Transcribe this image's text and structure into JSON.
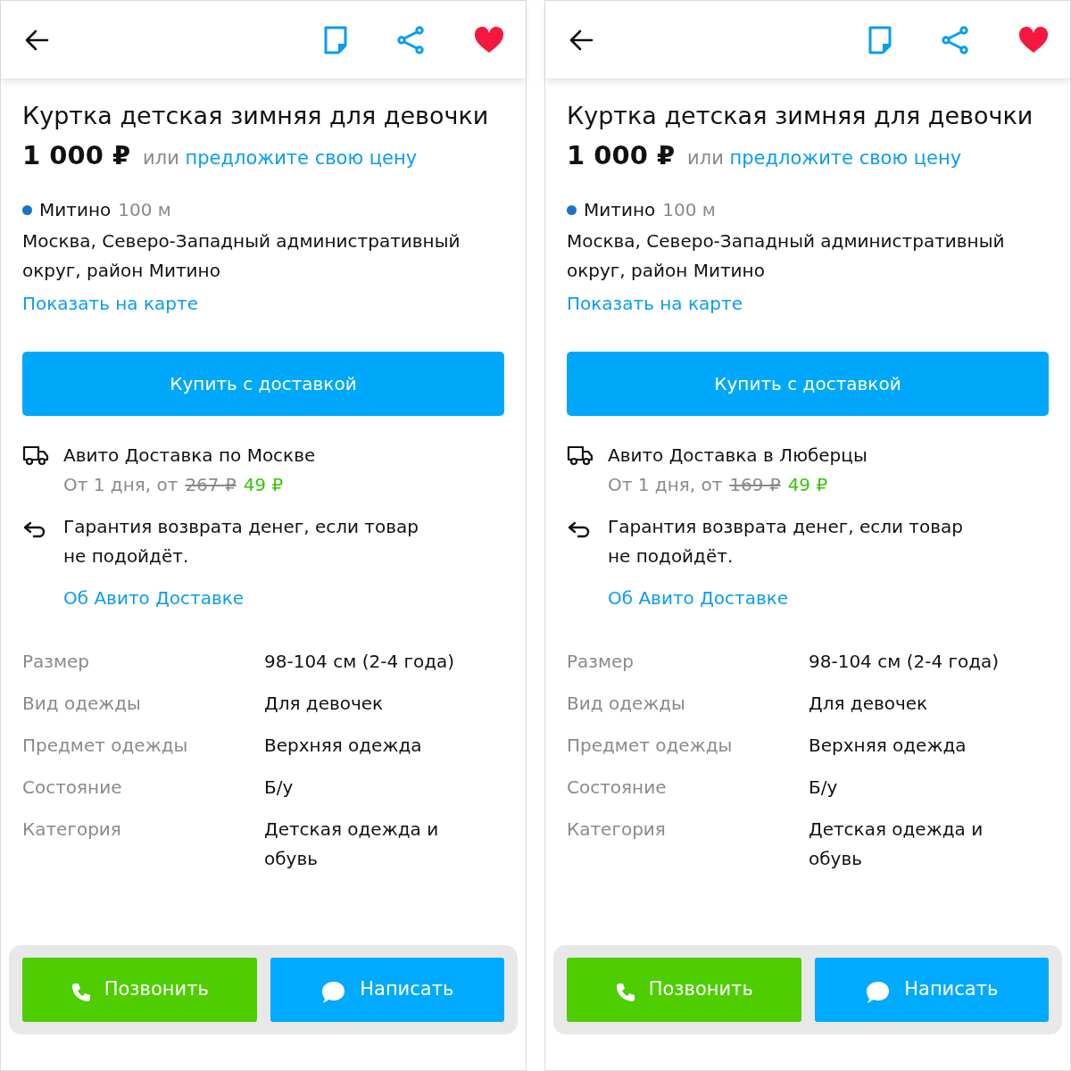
{
  "screens": [
    {
      "favorite": true,
      "title": "Куртка детская зимняя для девочки",
      "price": "1 000 ₽",
      "price_or": "или",
      "offer_link": "предложите свою цену",
      "metro": {
        "station": "Митино",
        "distance": "100 м",
        "color": "#1a73c8"
      },
      "address": "Москва, Северо-Западный административный округ, район Митино",
      "map_link": "Показать на карте",
      "buy_button": "Купить с доставкой",
      "delivery": {
        "title": "Авито Доставка по Москве",
        "terms": "От 1 дня, от",
        "old_price": "267 ₽",
        "new_price": "49 ₽"
      },
      "guarantee": "Гарантия возврата денег, если товар не подойдёт.",
      "about_link": "Об Авито Доставке",
      "params": [
        {
          "label": "Размер",
          "value": "98-104 см (2-4 года)"
        },
        {
          "label": "Вид одежды",
          "value": "Для девочек"
        },
        {
          "label": "Предмет одежды",
          "value": "Верхняя одежда"
        },
        {
          "label": "Состояние",
          "value": "Б/у"
        },
        {
          "label": "Категория",
          "value": "Детская одежда и обувь"
        }
      ],
      "call_button": "Позвонить",
      "write_button": "Написать"
    },
    {
      "favorite": true,
      "title": "Куртка детская зимняя для девочки",
      "price": "1 000 ₽",
      "price_or": "или",
      "offer_link": "предложите свою цену",
      "metro": {
        "station": "Митино",
        "distance": "100 м",
        "color": "#1a73c8"
      },
      "address": "Москва, Северо-Западный административный округ, район Митино",
      "map_link": "Показать на карте",
      "buy_button": "Купить с доставкой",
      "delivery": {
        "title": "Авито Доставка в Люберцы",
        "terms": "От 1 дня, от",
        "old_price": "169 ₽",
        "new_price": "49 ₽"
      },
      "guarantee": "Гарантия возврата денег, если товар не подойдёт.",
      "about_link": "Об Авито Доставке",
      "params": [
        {
          "label": "Размер",
          "value": "98-104 см (2-4 года)"
        },
        {
          "label": "Вид одежды",
          "value": "Для девочек"
        },
        {
          "label": "Предмет одежды",
          "value": "Верхняя одежда"
        },
        {
          "label": "Состояние",
          "value": "Б/у"
        },
        {
          "label": "Категория",
          "value": "Детская одежда и обувь"
        }
      ],
      "call_button": "Позвонить",
      "write_button": "Написать"
    }
  ]
}
